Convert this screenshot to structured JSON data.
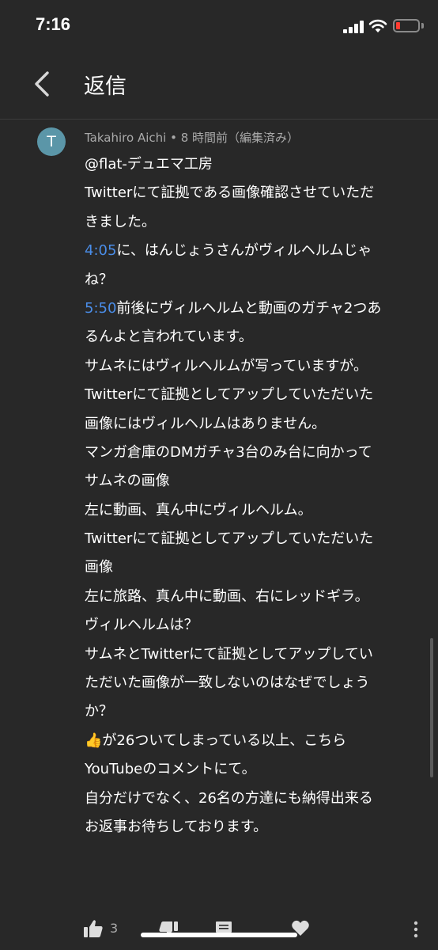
{
  "status_bar": {
    "time": "7:16",
    "battery_color": "#ff3b30"
  },
  "header": {
    "back_icon": "chevron-left-icon",
    "title": "返信"
  },
  "comment": {
    "avatar_letter": "T",
    "avatar_color": "#5b96a8",
    "author": "Takahiro Aichi",
    "separator": "•",
    "time_ago": "8 時間前（編集済み）",
    "lines": [
      {
        "text": "@flat-デュエマ工房"
      },
      {
        "text": "Twitterにて証拠である画像確認させていただ"
      },
      {
        "text": "きました。"
      },
      {
        "timestamp": "4:05",
        "text": "に、はんじょうさんがヴィルヘルムじゃ"
      },
      {
        "text": "ね？"
      },
      {
        "timestamp": "5:50",
        "text": "前後にヴィルヘルムと動画のガチャ2つあ"
      },
      {
        "text": "るんよと言われています。"
      },
      {
        "text": "サムネにはヴィルヘルムが写っていますが。"
      },
      {
        "text": "Twitterにて証拠としてアップしていただいた"
      },
      {
        "text": "画像にはヴィルヘルムはありません。"
      },
      {
        "text": "マンガ倉庫のDMガチャ3台のみ台に向かって"
      },
      {
        "text": "サムネの画像"
      },
      {
        "text": "左に動画、真ん中にヴィルヘルム。"
      },
      {
        "text": "Twitterにて証拠としてアップしていただいた"
      },
      {
        "text": "画像"
      },
      {
        "text": "左に旅路、真ん中に動画、右にレッドギラ。"
      },
      {
        "text": "ヴィルヘルムは？"
      },
      {
        "text": "サムネとTwitterにて証拠としてアップしてい"
      },
      {
        "text": "ただいた画像が一致しないのはなぜでしょう"
      },
      {
        "text": "か？"
      },
      {
        "emoji": "👍",
        "text": "が26ついてしまっている以上、こちら"
      },
      {
        "text": "YouTubeのコメントにて。"
      },
      {
        "text": "自分だけでなく、26名の方達にも納得出来る"
      },
      {
        "text": "お返事お待ちしております。"
      }
    ],
    "link_color": "#4a8de8"
  },
  "actions": {
    "like_count": "3",
    "like_icon": "thumbs-up-icon",
    "dislike_icon": "thumbs-down-icon",
    "reply_icon": "comment-icon",
    "heart_icon": "heart-icon",
    "more_icon": "more-vertical-icon"
  }
}
